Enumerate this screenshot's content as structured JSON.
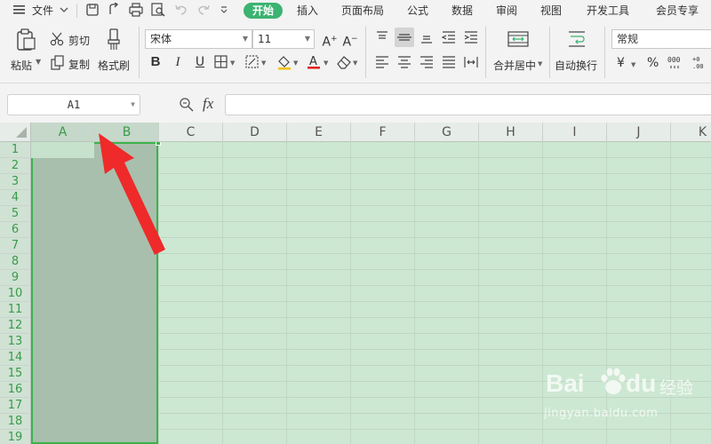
{
  "menu": {
    "file": "文件",
    "tabs": [
      "开始",
      "插入",
      "页面布局",
      "公式",
      "数据",
      "审阅",
      "视图",
      "开发工具",
      "会员专享"
    ],
    "active_tab": "开始",
    "accent": "#3cb371"
  },
  "ribbon": {
    "paste": "粘贴",
    "cut": "剪切",
    "copy": "复制",
    "format_painter": "格式刷",
    "font_name": "宋体",
    "font_size": "11",
    "merge_center": "合并居中",
    "wrap_text": "自动换行",
    "number_format": "常规",
    "currency_symbol": "¥",
    "percent_symbol": "%"
  },
  "formula_bar": {
    "name_box": "A1",
    "fx": "fx",
    "value": ""
  },
  "grid": {
    "columns": [
      "A",
      "B",
      "C",
      "D",
      "E",
      "F",
      "G",
      "H",
      "I",
      "J",
      "K"
    ],
    "rows": [
      "1",
      "2",
      "3",
      "4",
      "5",
      "6",
      "7",
      "8",
      "9",
      "10",
      "11",
      "12",
      "13",
      "14",
      "15",
      "16",
      "17",
      "18",
      "19"
    ],
    "selected_columns": [
      "A",
      "B"
    ]
  },
  "watermark": {
    "brand": "Bai",
    "brand_suffix": "du",
    "cn": "经验",
    "url": "jingyan.baidu.com"
  },
  "colors": {
    "selection_border": "#3cb34a",
    "arrow": "#ee2a2a"
  }
}
